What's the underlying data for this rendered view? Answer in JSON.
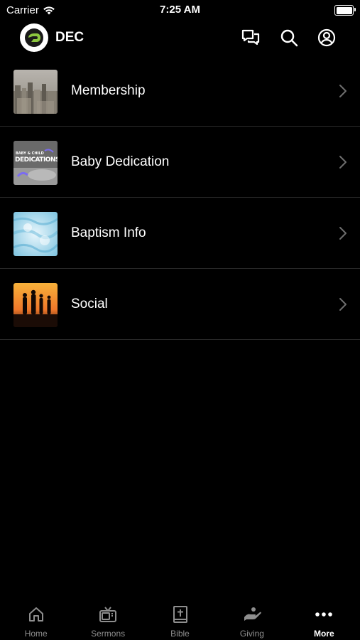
{
  "status_bar": {
    "carrier": "Carrier",
    "time": "7:25 AM"
  },
  "header": {
    "title": "DEC",
    "icons": [
      "chat-icon",
      "search-icon",
      "account-icon"
    ]
  },
  "menu": {
    "items": [
      {
        "label": "Membership",
        "thumb": "city-skyline-image"
      },
      {
        "label": "Baby Dedication",
        "thumb": "baby-dedications-image",
        "thumb_text_top": "BABY & CHILD",
        "thumb_text": "DEDICATIONS"
      },
      {
        "label": "Baptism Info",
        "thumb": "water-image"
      },
      {
        "label": "Social",
        "thumb": "sunset-silhouette-image"
      }
    ]
  },
  "tabs": [
    {
      "label": "Home",
      "icon": "home-icon",
      "active": false
    },
    {
      "label": "Sermons",
      "icon": "tv-icon",
      "active": false
    },
    {
      "label": "Bible",
      "icon": "bible-icon",
      "active": false
    },
    {
      "label": "Giving",
      "icon": "giving-hand-icon",
      "active": false
    },
    {
      "label": "More",
      "icon": "more-icon",
      "active": true
    }
  ],
  "colors": {
    "background": "#000000",
    "text": "#ffffff",
    "inactive_tab": "#8e8e8e",
    "divider": "#2a2a2a",
    "logo_accent": "#8cc63f"
  }
}
